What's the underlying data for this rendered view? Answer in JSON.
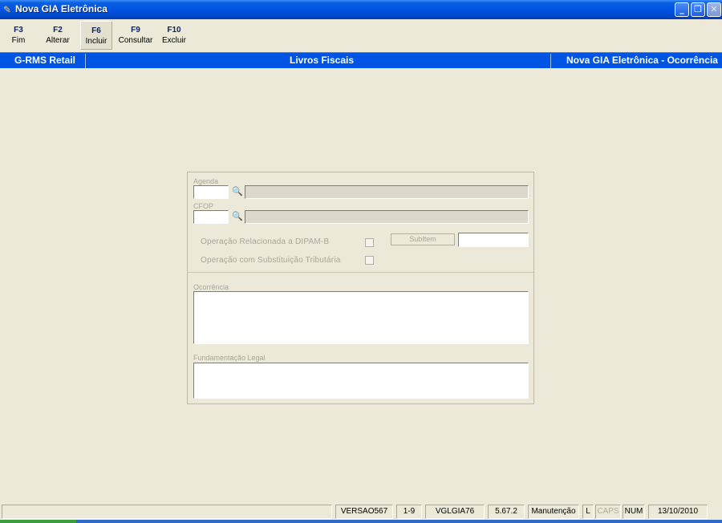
{
  "window": {
    "title": "Nova GIA Eletrônica",
    "controls": {
      "minimize": "_",
      "restore": "❐",
      "close": "✕"
    }
  },
  "toolbar": [
    {
      "key": "F3",
      "label": "Fim"
    },
    {
      "key": "F2",
      "label": "Alterar"
    },
    {
      "key": "F6",
      "label": "Incluir"
    },
    {
      "key": "F9",
      "label": "Consultar"
    },
    {
      "key": "F10",
      "label": "Excluir"
    }
  ],
  "header": {
    "left": "G-RMS Retail",
    "center": "Livros Fiscais",
    "right": "Nova GIA Eletrônica - Ocorrência"
  },
  "form": {
    "agenda_label": "Agenda",
    "cfop_label": "CFOP",
    "dipam_label": "Operação Relacionada a DIPAM-B",
    "st_label": "Operação com Substituição Tributária",
    "subitem_label": "SubItem",
    "ocorrencia_label": "Ocorrência",
    "fundamentacao_label": "Fundamentação Legal",
    "search_icon": "binoculars-icon"
  },
  "status": {
    "versao": "VERSAO567",
    "range": "1-9",
    "program": "VGLGIA76",
    "version_num": "5.67.2",
    "mode": "Manutenção",
    "l": "L",
    "caps": "CAPS",
    "num": "NUM",
    "date": "13/10/2010"
  }
}
